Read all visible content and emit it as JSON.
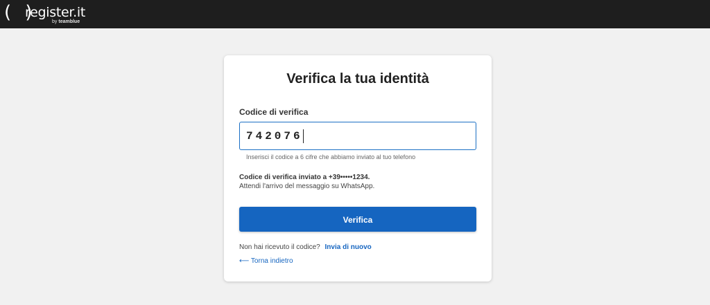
{
  "header": {
    "logo_paren": "( )",
    "logo_text": "register.it",
    "logo_sub_by": "by",
    "logo_sub_brand": "teamblue"
  },
  "card": {
    "title": "Verifica la tua identità",
    "field_label": "Codice di verifica",
    "code_value": "742076",
    "helper_text": "Inserisci il codice a 6 cifre che abbiamo inviato al tuo telefono",
    "status_line1": "Codice di verifica inviato a +39•••••1234.",
    "status_line2": "Attendi l'arrivo del messaggio su WhatsApp.",
    "verify_button": "Verifica",
    "resend_prompt": "Non hai ricevuto il codice?",
    "resend_link": "Invia di nuovo",
    "back_link": "⟵ Torna indietro"
  },
  "colors": {
    "topbar": "#1e1e1e",
    "page_bg": "#f1f1f1",
    "accent": "#1565c0"
  }
}
